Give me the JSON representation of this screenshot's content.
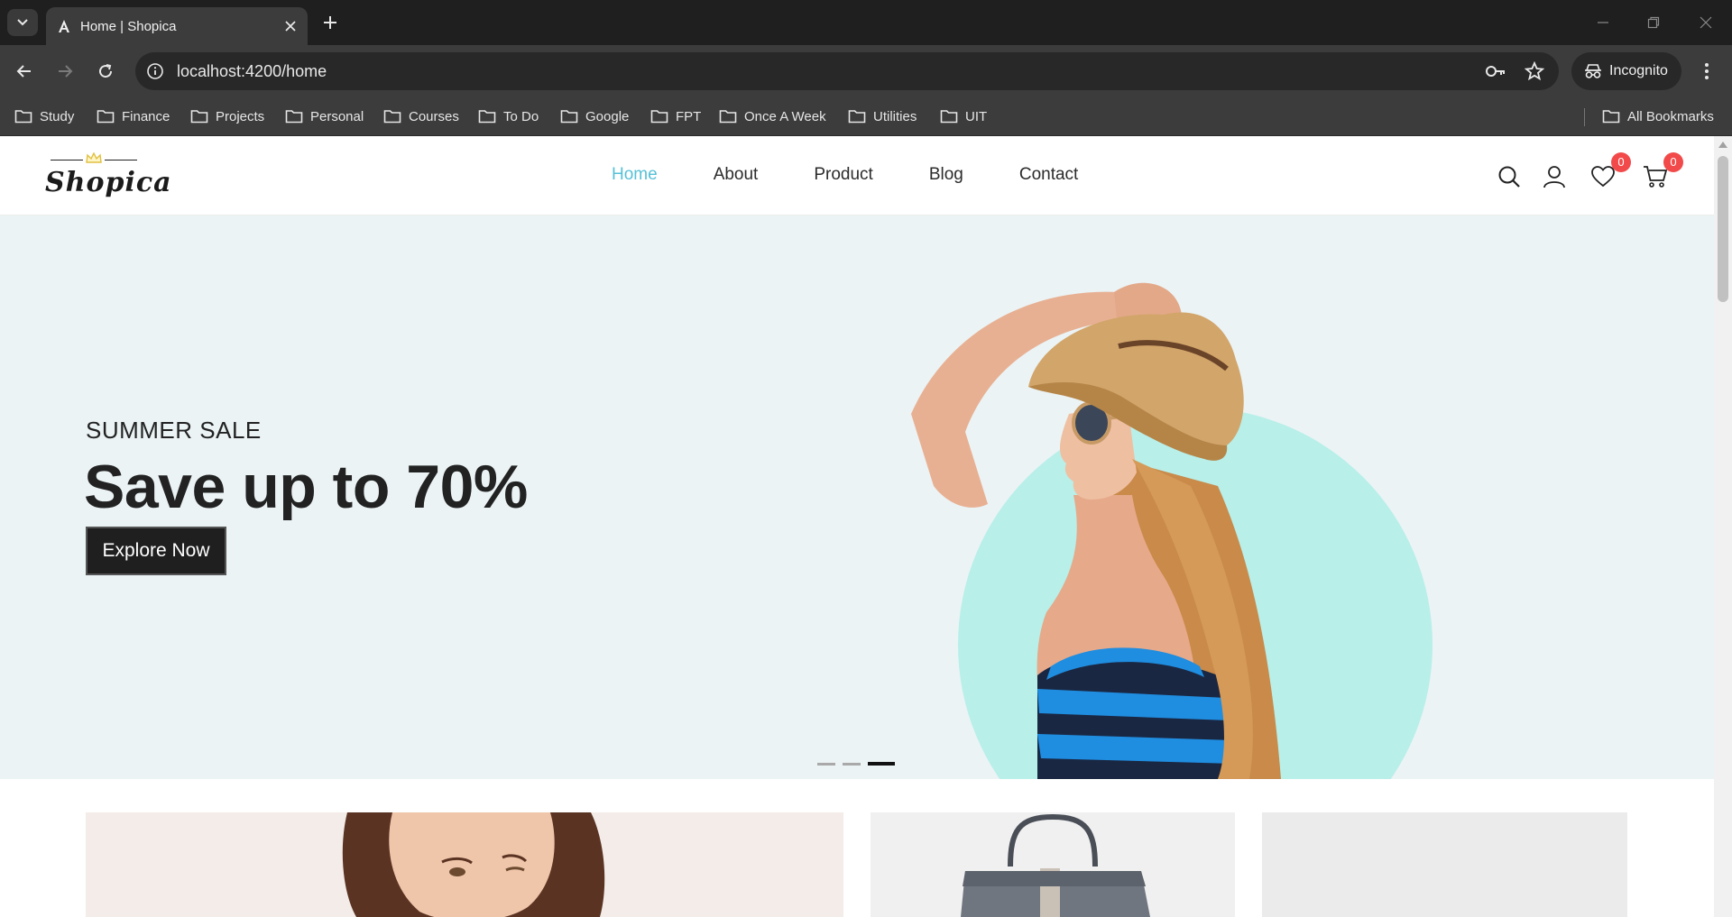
{
  "browser": {
    "tab_title": "Home | Shopica",
    "url": "localhost:4200/home",
    "incognito_label": "Incognito",
    "bookmarks": [
      "Study",
      "Finance",
      "Projects",
      "Personal",
      "Courses",
      "To Do",
      "Google",
      "FPT",
      "Once A Week",
      "Utilities",
      "UIT"
    ],
    "all_bookmarks_label": "All Bookmarks"
  },
  "site": {
    "logo_text": "Shopica",
    "nav": [
      "Home",
      "About",
      "Product",
      "Blog",
      "Contact"
    ],
    "active_nav": "Home",
    "wishlist_count": "0",
    "cart_count": "0",
    "accent_color": "#56c1d6",
    "badge_color": "#f24a4a"
  },
  "hero": {
    "subtitle": "SUMMER SALE",
    "title": "Save up to 70%",
    "button_label": "Explore Now",
    "slides_total": 3,
    "active_slide": 3,
    "circle_color": "#b8efe9"
  }
}
